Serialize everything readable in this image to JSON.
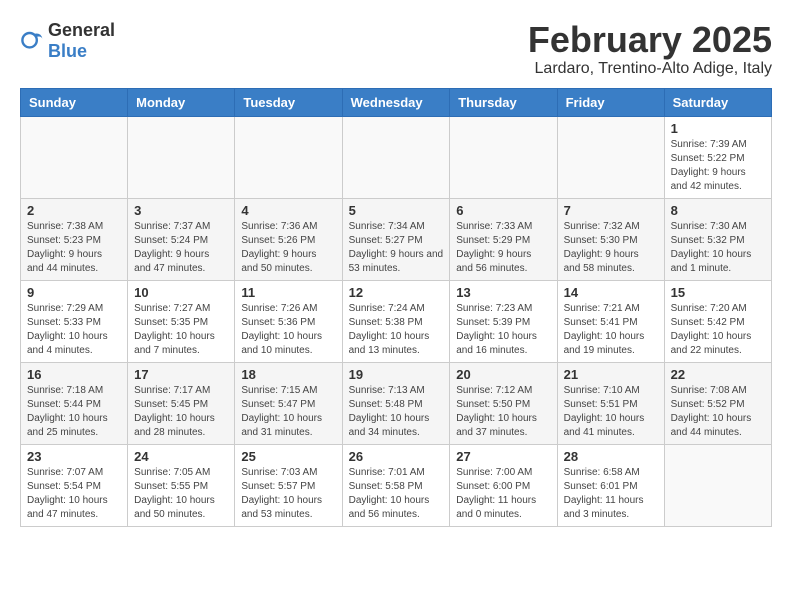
{
  "header": {
    "logo_general": "General",
    "logo_blue": "Blue",
    "title": "February 2025",
    "subtitle": "Lardaro, Trentino-Alto Adige, Italy"
  },
  "weekdays": [
    "Sunday",
    "Monday",
    "Tuesday",
    "Wednesday",
    "Thursday",
    "Friday",
    "Saturday"
  ],
  "weeks": [
    [
      {
        "day": "",
        "info": ""
      },
      {
        "day": "",
        "info": ""
      },
      {
        "day": "",
        "info": ""
      },
      {
        "day": "",
        "info": ""
      },
      {
        "day": "",
        "info": ""
      },
      {
        "day": "",
        "info": ""
      },
      {
        "day": "1",
        "info": "Sunrise: 7:39 AM\nSunset: 5:22 PM\nDaylight: 9 hours and 42 minutes."
      }
    ],
    [
      {
        "day": "2",
        "info": "Sunrise: 7:38 AM\nSunset: 5:23 PM\nDaylight: 9 hours and 44 minutes."
      },
      {
        "day": "3",
        "info": "Sunrise: 7:37 AM\nSunset: 5:24 PM\nDaylight: 9 hours and 47 minutes."
      },
      {
        "day": "4",
        "info": "Sunrise: 7:36 AM\nSunset: 5:26 PM\nDaylight: 9 hours and 50 minutes."
      },
      {
        "day": "5",
        "info": "Sunrise: 7:34 AM\nSunset: 5:27 PM\nDaylight: 9 hours and 53 minutes."
      },
      {
        "day": "6",
        "info": "Sunrise: 7:33 AM\nSunset: 5:29 PM\nDaylight: 9 hours and 56 minutes."
      },
      {
        "day": "7",
        "info": "Sunrise: 7:32 AM\nSunset: 5:30 PM\nDaylight: 9 hours and 58 minutes."
      },
      {
        "day": "8",
        "info": "Sunrise: 7:30 AM\nSunset: 5:32 PM\nDaylight: 10 hours and 1 minute."
      }
    ],
    [
      {
        "day": "9",
        "info": "Sunrise: 7:29 AM\nSunset: 5:33 PM\nDaylight: 10 hours and 4 minutes."
      },
      {
        "day": "10",
        "info": "Sunrise: 7:27 AM\nSunset: 5:35 PM\nDaylight: 10 hours and 7 minutes."
      },
      {
        "day": "11",
        "info": "Sunrise: 7:26 AM\nSunset: 5:36 PM\nDaylight: 10 hours and 10 minutes."
      },
      {
        "day": "12",
        "info": "Sunrise: 7:24 AM\nSunset: 5:38 PM\nDaylight: 10 hours and 13 minutes."
      },
      {
        "day": "13",
        "info": "Sunrise: 7:23 AM\nSunset: 5:39 PM\nDaylight: 10 hours and 16 minutes."
      },
      {
        "day": "14",
        "info": "Sunrise: 7:21 AM\nSunset: 5:41 PM\nDaylight: 10 hours and 19 minutes."
      },
      {
        "day": "15",
        "info": "Sunrise: 7:20 AM\nSunset: 5:42 PM\nDaylight: 10 hours and 22 minutes."
      }
    ],
    [
      {
        "day": "16",
        "info": "Sunrise: 7:18 AM\nSunset: 5:44 PM\nDaylight: 10 hours and 25 minutes."
      },
      {
        "day": "17",
        "info": "Sunrise: 7:17 AM\nSunset: 5:45 PM\nDaylight: 10 hours and 28 minutes."
      },
      {
        "day": "18",
        "info": "Sunrise: 7:15 AM\nSunset: 5:47 PM\nDaylight: 10 hours and 31 minutes."
      },
      {
        "day": "19",
        "info": "Sunrise: 7:13 AM\nSunset: 5:48 PM\nDaylight: 10 hours and 34 minutes."
      },
      {
        "day": "20",
        "info": "Sunrise: 7:12 AM\nSunset: 5:50 PM\nDaylight: 10 hours and 37 minutes."
      },
      {
        "day": "21",
        "info": "Sunrise: 7:10 AM\nSunset: 5:51 PM\nDaylight: 10 hours and 41 minutes."
      },
      {
        "day": "22",
        "info": "Sunrise: 7:08 AM\nSunset: 5:52 PM\nDaylight: 10 hours and 44 minutes."
      }
    ],
    [
      {
        "day": "23",
        "info": "Sunrise: 7:07 AM\nSunset: 5:54 PM\nDaylight: 10 hours and 47 minutes."
      },
      {
        "day": "24",
        "info": "Sunrise: 7:05 AM\nSunset: 5:55 PM\nDaylight: 10 hours and 50 minutes."
      },
      {
        "day": "25",
        "info": "Sunrise: 7:03 AM\nSunset: 5:57 PM\nDaylight: 10 hours and 53 minutes."
      },
      {
        "day": "26",
        "info": "Sunrise: 7:01 AM\nSunset: 5:58 PM\nDaylight: 10 hours and 56 minutes."
      },
      {
        "day": "27",
        "info": "Sunrise: 7:00 AM\nSunset: 6:00 PM\nDaylight: 11 hours and 0 minutes."
      },
      {
        "day": "28",
        "info": "Sunrise: 6:58 AM\nSunset: 6:01 PM\nDaylight: 11 hours and 3 minutes."
      },
      {
        "day": "",
        "info": ""
      }
    ]
  ]
}
